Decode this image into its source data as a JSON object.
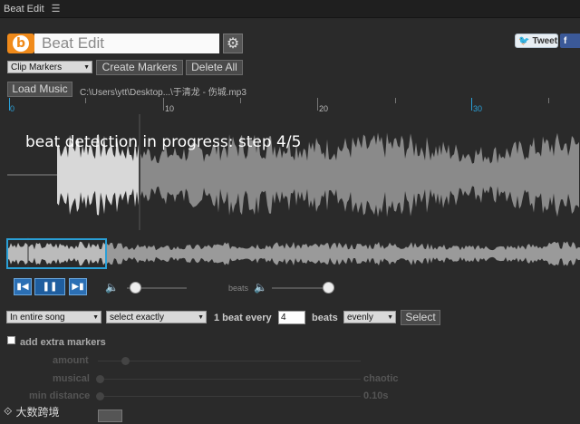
{
  "window": {
    "title": "Beat Edit",
    "menu_icon": "hamburger-icon"
  },
  "header": {
    "app_name": "Beat Edit",
    "logo_letter": "b",
    "tweet_label": "Tweet",
    "facebook_letter": "f"
  },
  "toolbar": {
    "marker_type": "Clip Markers",
    "create_markers": "Create Markers",
    "delete_all": "Delete All",
    "load_music": "Load Music",
    "file_path": "C:\\Users\\ytt\\Desktop...\\于清龙 - 伤城.mp3"
  },
  "ruler": {
    "labels": [
      "0",
      "10",
      "20",
      "30"
    ]
  },
  "status": {
    "message": "beat detection in progress: step 4/5"
  },
  "transport": {
    "prev_icon": "skip-previous-icon",
    "pause_icon": "pause-icon",
    "next_icon": "skip-next-icon",
    "beats_label": "beats"
  },
  "beats_row": {
    "scope": "In entire song",
    "mode": "select exactly",
    "prefix": "1 beat every",
    "every_value": "4",
    "unit": "beats",
    "distribution": "evenly",
    "select_button": "Select"
  },
  "extra": {
    "add_label": "add extra markers",
    "amount_label": "amount",
    "musical_label": "musical",
    "chaotic_label": "chaotic",
    "min_distance_label": "min distance",
    "min_distance_value": "0.10s"
  },
  "watermark": {
    "text": "大数跨境"
  }
}
